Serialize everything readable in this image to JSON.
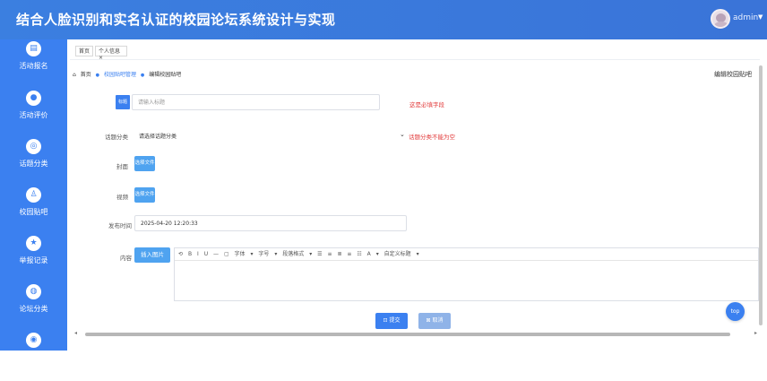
{
  "app": {
    "title": "结合人脸识别和实名认证的校园论坛系统设计与实现"
  },
  "user": {
    "name": "admin"
  },
  "sidebar": {
    "items": [
      {
        "label": "活动报名",
        "icon": "doc-icon"
      },
      {
        "label": "活动评价",
        "icon": "comment-icon"
      },
      {
        "label": "话题分类",
        "icon": "tag-icon"
      },
      {
        "label": "校园贴吧",
        "icon": "user-icon"
      },
      {
        "label": "举报记录",
        "icon": "star-icon"
      },
      {
        "label": "论坛分类",
        "icon": "thumb-icon"
      }
    ]
  },
  "tabs": [
    {
      "label": "首页"
    },
    {
      "label": "个人信息×"
    }
  ],
  "breadcrumb": {
    "home": "首页",
    "section": "校园贴吧管理",
    "current": "编辑校园贴吧"
  },
  "page_title": "编辑校园贴吧",
  "form": {
    "title_badge": "标题",
    "title_placeholder": "请输入标题",
    "title_hint": "这是必填字段",
    "topic_label": "话题分类",
    "topic_value": "请选择话题分类",
    "topic_hint": "话题分类不能为空",
    "cover_label": "封面",
    "video_label": "视频",
    "file_button": "选择文件",
    "time_label": "发布时间",
    "time_value": "2025-04-20 12:20:33",
    "content_label": "内容",
    "insert_image": "插入图片",
    "toolbar_items": [
      "B",
      "I",
      "U",
      "—",
      "字体",
      "字号",
      "段落格式",
      "A",
      "自定义标题"
    ]
  },
  "actions": {
    "submit": "提交",
    "cancel": "取消"
  },
  "top_button": "top"
}
